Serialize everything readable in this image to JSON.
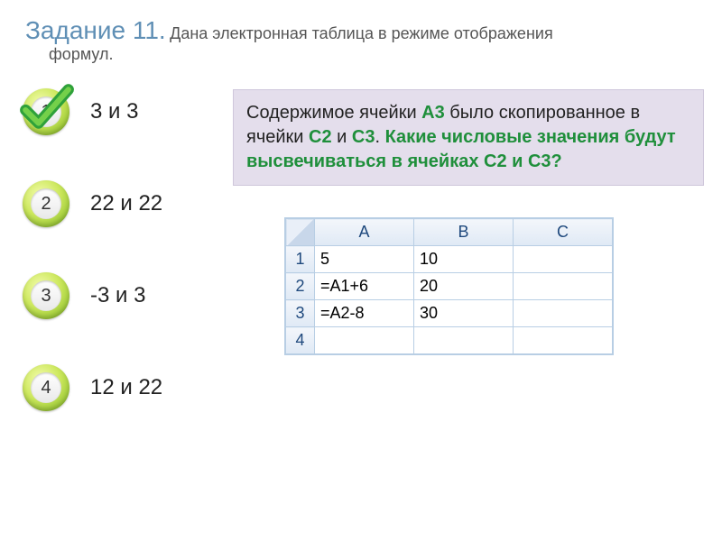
{
  "title_prefix": "Задание 11.",
  "title_rest": " Дана электронная таблица в режиме отображения",
  "title_line2": "формул.",
  "options": [
    {
      "num": "1",
      "text": "3 и 3",
      "correct": true
    },
    {
      "num": "2",
      "text": "22 и 22",
      "correct": false
    },
    {
      "num": "3",
      "text": "-3 и 3",
      "correct": false
    },
    {
      "num": "4",
      "text": "12 и 22",
      "correct": false
    }
  ],
  "hint": {
    "p1a": "Содержимое ячейки ",
    "p1b": "А3",
    "p1c": " было скопированное в ячейки ",
    "p1d": "С2",
    "p1e": " и ",
    "p1f": "С3",
    "p1g": ". ",
    "p2": "Какие числовые значения будут высвечиваться в ячейках С2 и С3?"
  },
  "sheet": {
    "cols": [
      "A",
      "B",
      "C"
    ],
    "rows": [
      {
        "n": "1",
        "cells": [
          "5",
          "10",
          ""
        ]
      },
      {
        "n": "2",
        "cells": [
          "=А1+6",
          "20",
          ""
        ]
      },
      {
        "n": "3",
        "cells": [
          "=А2-8",
          "30",
          ""
        ]
      },
      {
        "n": "4",
        "cells": [
          "",
          "",
          ""
        ]
      }
    ]
  }
}
